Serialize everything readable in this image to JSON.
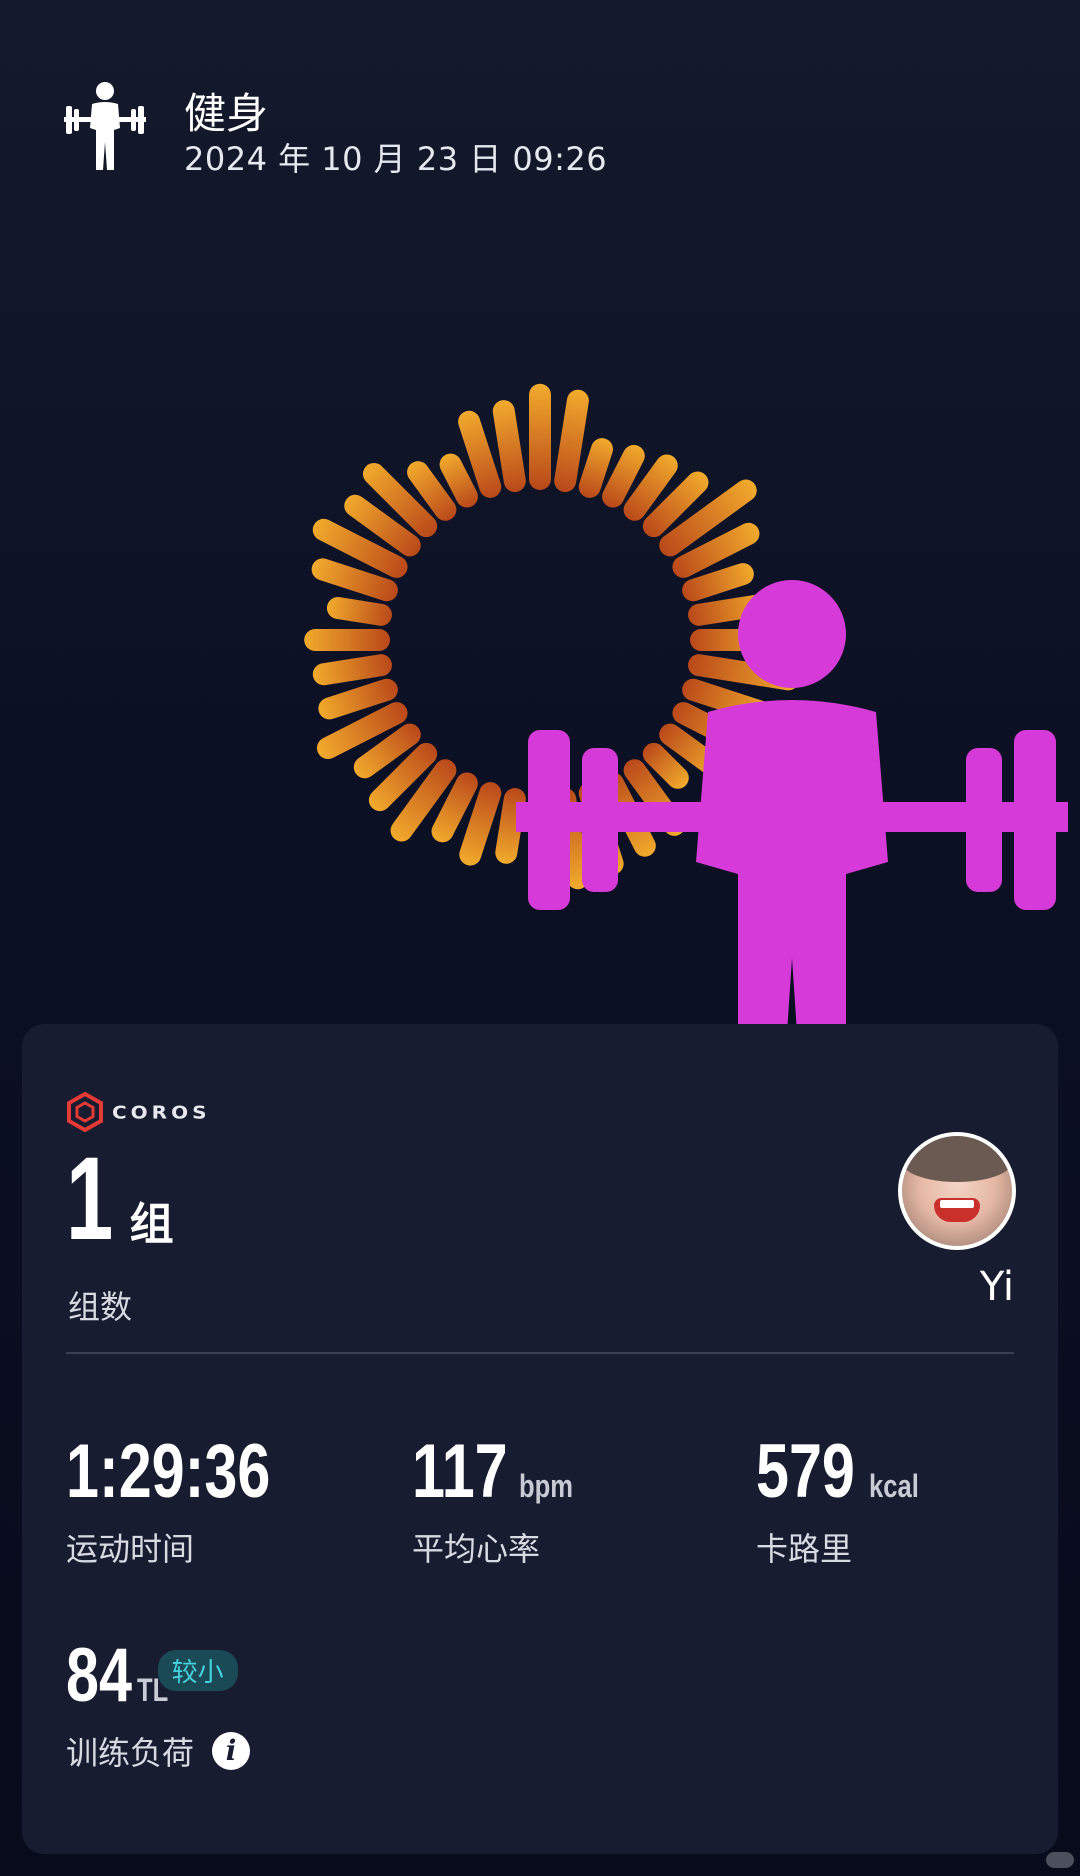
{
  "header": {
    "icon": "weightlifting-icon",
    "title": "健身",
    "datetime": "2024 年 10 月 23 日 09:26"
  },
  "activity_ring": {
    "center_icon": "weightlifting-icon",
    "center_icon_color": "#d63ad9",
    "bar_gradient": [
      "#f0a62a",
      "#b84a12"
    ]
  },
  "card": {
    "brand": {
      "logo_icon": "coros-hexagon-icon",
      "name": "COROS",
      "logo_color": "#e53935"
    },
    "sets": {
      "value": "1",
      "unit": "组",
      "label": "组数"
    },
    "user": {
      "avatar": "user-avatar",
      "name": "Yi"
    },
    "stats": [
      {
        "value": "1:29:36",
        "unit": "",
        "label": "运动时间"
      },
      {
        "value": "117",
        "unit": "bpm",
        "label": "平均心率"
      },
      {
        "value": "579",
        "unit": "kcal",
        "label": "卡路里"
      }
    ],
    "training_load": {
      "value": "84",
      "unit": "TL",
      "badge": "较小",
      "label": "训练负荷",
      "info_icon": "info-icon"
    }
  }
}
